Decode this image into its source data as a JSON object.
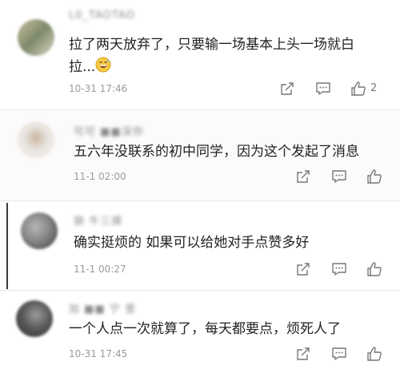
{
  "comments": [
    {
      "username": "L0_TAOTAO",
      "text_line1": "拉了两天放弃了，只要输一场基本上头一场就白",
      "text_line2": "拉...",
      "time": "10-31 17:46",
      "likes": "2",
      "avatar_colors": [
        "#b8a98a",
        "#7c8a6a",
        "#d7d0c2"
      ]
    },
    {
      "username": "可可 ■■深你",
      "text_line1": "五六年没联系的初中同学，因为这个发起了消息",
      "time": "11-1 02:00",
      "avatar_colors": [
        "#e9e4df",
        "#c9b7a3",
        "#f3efea"
      ]
    },
    {
      "username": "狼 牛三摸",
      "text_line1": "确实挺烦的 如果可以给她对手点赞多好",
      "time": "11-1 00:27",
      "avatar_colors": [
        "#4d4d4d",
        "#8c8c8c",
        "#b5b5b5"
      ]
    },
    {
      "username": "加 ■■ 宁 里",
      "text_line1": "一个人点一次就算了，每天都要点，烦死人了",
      "time": "10-31 17:45",
      "avatar_colors": [
        "#5a5a5a",
        "#9b9b9b",
        "#3d3d3d"
      ]
    }
  ],
  "icons": {
    "share": "share-icon",
    "reply": "comment-icon",
    "like": "thumbs-up-icon",
    "emoji": "grinning-sweat-emoji"
  }
}
